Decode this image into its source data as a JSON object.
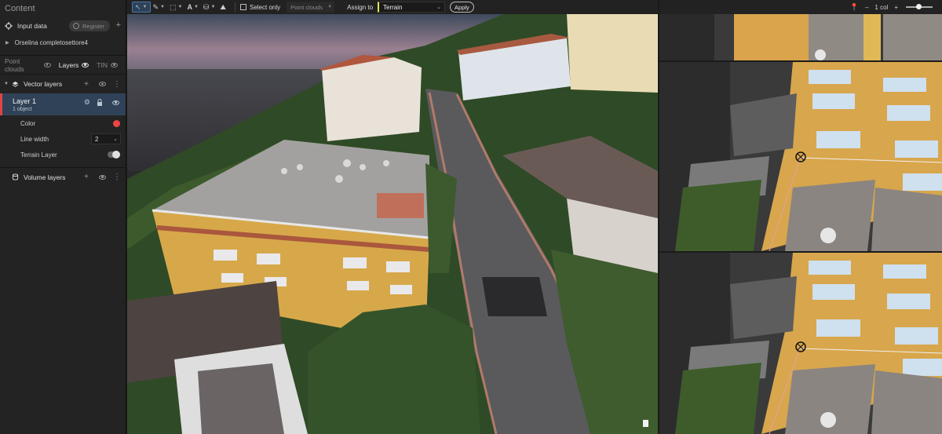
{
  "sidebar": {
    "title": "Content",
    "input_data": {
      "label": "Input data",
      "register_label": "Register"
    },
    "dataset": {
      "label": "Orselina completosettore4"
    },
    "tabs": [
      {
        "label": "Point clouds"
      },
      {
        "label": "Layers"
      },
      {
        "label": "TIN"
      }
    ],
    "vector_layers": {
      "label": "Vector layers",
      "layer": {
        "name": "Layer 1",
        "count": "1 object"
      },
      "props": {
        "color_label": "Color",
        "color_value": "#ef4444",
        "line_width_label": "Line width",
        "line_width_value": "2",
        "terrain_label": "Terrain Layer"
      }
    },
    "volume_layers": {
      "label": "Volume layers"
    }
  },
  "toolbar": {
    "select_only_label": "Select only",
    "pointclouds_placeholder": "Point clouds",
    "assign_label": "Assign to",
    "assign_value": "Terrain",
    "apply_label": "Apply"
  },
  "right_toolbar": {
    "columns_label": "1 col"
  },
  "icons": [
    "cursor-icon",
    "pen-icon",
    "box-select-icon",
    "text-icon",
    "cylinder-icon",
    "terrain-icon",
    "eye-icon",
    "gear-icon",
    "lock-icon",
    "pin-icon"
  ]
}
